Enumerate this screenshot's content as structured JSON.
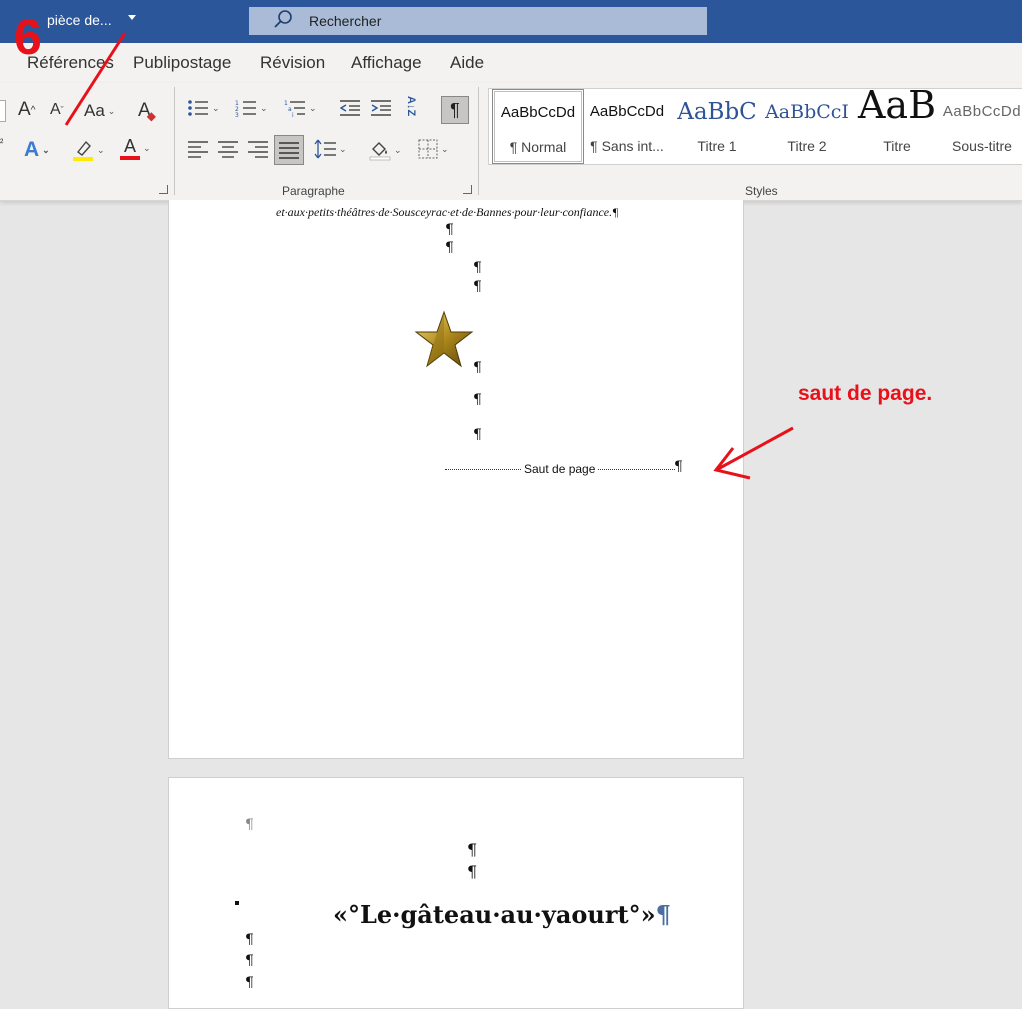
{
  "titlebar": {
    "document_name": "pièce de...",
    "search_placeholder": "Rechercher"
  },
  "menu_tabs": [
    "Références",
    "Publipostage",
    "Révision",
    "Affichage",
    "Aide"
  ],
  "ribbon": {
    "paragraph_group_label": "Paragraphe",
    "styles_group_label": "Styles",
    "font_buttons": {
      "grow": "A",
      "shrink": "A",
      "case": "Aa",
      "clear_format": "A",
      "text_effects": "A",
      "font_color": "A",
      "subscript_fragment": "²"
    },
    "show_marks_symbol": "¶",
    "sort_symbol": "A↓Z",
    "colors": {
      "highlight": "#ffeb00",
      "font_color": "#e8111a",
      "accent": "#2b579a"
    },
    "styles": [
      {
        "sample": "AaBbCcDd",
        "name": "¶ Normal"
      },
      {
        "sample": "AaBbCcDd",
        "name": "¶ Sans int..."
      },
      {
        "sample": "AaBbC",
        "name": "Titre 1"
      },
      {
        "sample": "AaBbCcI",
        "name": "Titre 2"
      },
      {
        "sample": "AaB",
        "name": "Titre"
      },
      {
        "sample": "AaBbCcDd",
        "name": "Sous-titre"
      }
    ]
  },
  "document": {
    "page1": {
      "italic_line": "et·aux·petits·théâtres·de·Sousceyrac·et·de·Bannes·pour·leur·confiance.¶",
      "pilcrow": "¶",
      "page_break_label": "Saut de page"
    },
    "page2": {
      "pilcrow": "¶",
      "title": "«°Le·gâteau·au·yaourt°»",
      "title_mark": "¶"
    }
  },
  "annotations": {
    "step_number": "6",
    "callout": "saut de page.",
    "color": "#e8111a"
  }
}
